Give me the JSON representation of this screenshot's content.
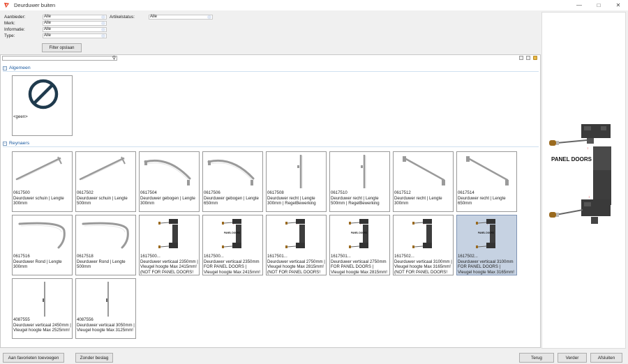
{
  "window": {
    "title": "Deurduwer buiten"
  },
  "filters": {
    "aanbieder": {
      "label": "Aanbieder:",
      "value": "Alle"
    },
    "merk": {
      "label": "Merk:",
      "value": "Alle"
    },
    "informatie": {
      "label": "Informatie:",
      "value": "Alle"
    },
    "type": {
      "label": "Type:",
      "value": "Alle"
    },
    "artikelstatus": {
      "label": "Artikelstatus:",
      "value": "Alle"
    },
    "save_label": "Filter opslaan"
  },
  "search": {
    "value": ""
  },
  "groups": [
    {
      "label": "Algemeen"
    },
    {
      "label": "Reynaers"
    }
  ],
  "tiles": [
    {
      "caption": "<geen>",
      "icon": "no-entry-icon"
    },
    {
      "caption": "0617500\nDeurduwer schuin   |   Lengte 300mm",
      "icon": "handle-diagonal-icon"
    },
    {
      "caption": "0617502\nDeurduwer schuin   |   Lengte 500mm",
      "icon": "handle-diagonal-icon"
    },
    {
      "caption": "0617504\nDeurduwer gebogen   |   Lengte 300mm",
      "icon": "handle-curved-icon"
    },
    {
      "caption": "0617506\nDeurduwer gebogen   |   Lengte 650mm",
      "icon": "handle-curved-icon"
    },
    {
      "caption": "0617508\nDeurduwer recht   |   Lengte 300mm   |   RegelBewerking",
      "icon": "handle-straight-icon"
    },
    {
      "caption": "0617510\nDeurduwer recht   |   Lengte 500mm   |   RegelBewerking",
      "icon": "handle-straight-icon"
    },
    {
      "caption": "0617512\nDeurduwer recht   |   Lengte 300mm",
      "icon": "handle-angled-icon"
    },
    {
      "caption": "0617514\nDeurduwer recht   |   Lengte 650mm",
      "icon": "handle-angled-icon"
    },
    {
      "caption": "0617516\nDeurduwer Rond   |   Lengte 300mm",
      "icon": "handle-round-icon"
    },
    {
      "caption": "0617518\nDeurduwer Rond   |   Lengte 500mm",
      "icon": "handle-round-icon"
    },
    {
      "caption": "1617500...\nDeurduwer verticaal   2350mm | Vleugel hoogte Max 2415mm! (NOT FOR PANEL DOORS!",
      "icon": "vertical-assembly-icon"
    },
    {
      "caption": "1617500...\nDeurduwer verticaal   2350mm FOR PANEL DOORS | Vleugel hoogte Max 2415mm!",
      "icon": "vertical-assembly-panel-icon"
    },
    {
      "caption": "1617501...\nDeurduwer verticaal   2750mm | Vleugel hoogte Max 2815mm! (NOT FOR PANEL DOORS!",
      "icon": "vertical-assembly-icon"
    },
    {
      "caption": "1617501...\nDeurduwer verticaal   2750mm FOR PANEL DOORS | Vleugel hoogte Max 2815mm!",
      "icon": "vertical-assembly-panel-icon"
    },
    {
      "caption": "1617502...\nDeurduwer verticaal   3100mm | Vleugel hoogte Max 3165mm! (NOT FOR PANEL DOORS!",
      "icon": "vertical-assembly-icon"
    },
    {
      "caption": "1617502...\nDeurduwer verticaal   3100mm FOR PANEL DOORS | Vleugel hoogte Max 3165mm!",
      "icon": "vertical-assembly-panel-icon",
      "selected": true
    },
    {
      "caption": "4087555\nDeurduwer verticaal   2450mm | Vleugel hoogte Max 2525mm!",
      "icon": "vertical-bar-icon"
    },
    {
      "caption": "4087556\nDeurduwer verticaal   3050mm | Vleugel hoogte Max 3125mm!",
      "icon": "vertical-bar-icon"
    }
  ],
  "preview": {
    "label": "PANEL DOORS"
  },
  "bottom": {
    "favorites": "Aan favorieten toevoegen",
    "no_fitting": "Zonder beslag",
    "back": "Terug",
    "next": "Verder",
    "close": "Afsluiten"
  },
  "colors": {
    "accent": "#1a5aa0",
    "selected_tile": "#c6d2e2",
    "no_entry": "#1f3a4d"
  }
}
